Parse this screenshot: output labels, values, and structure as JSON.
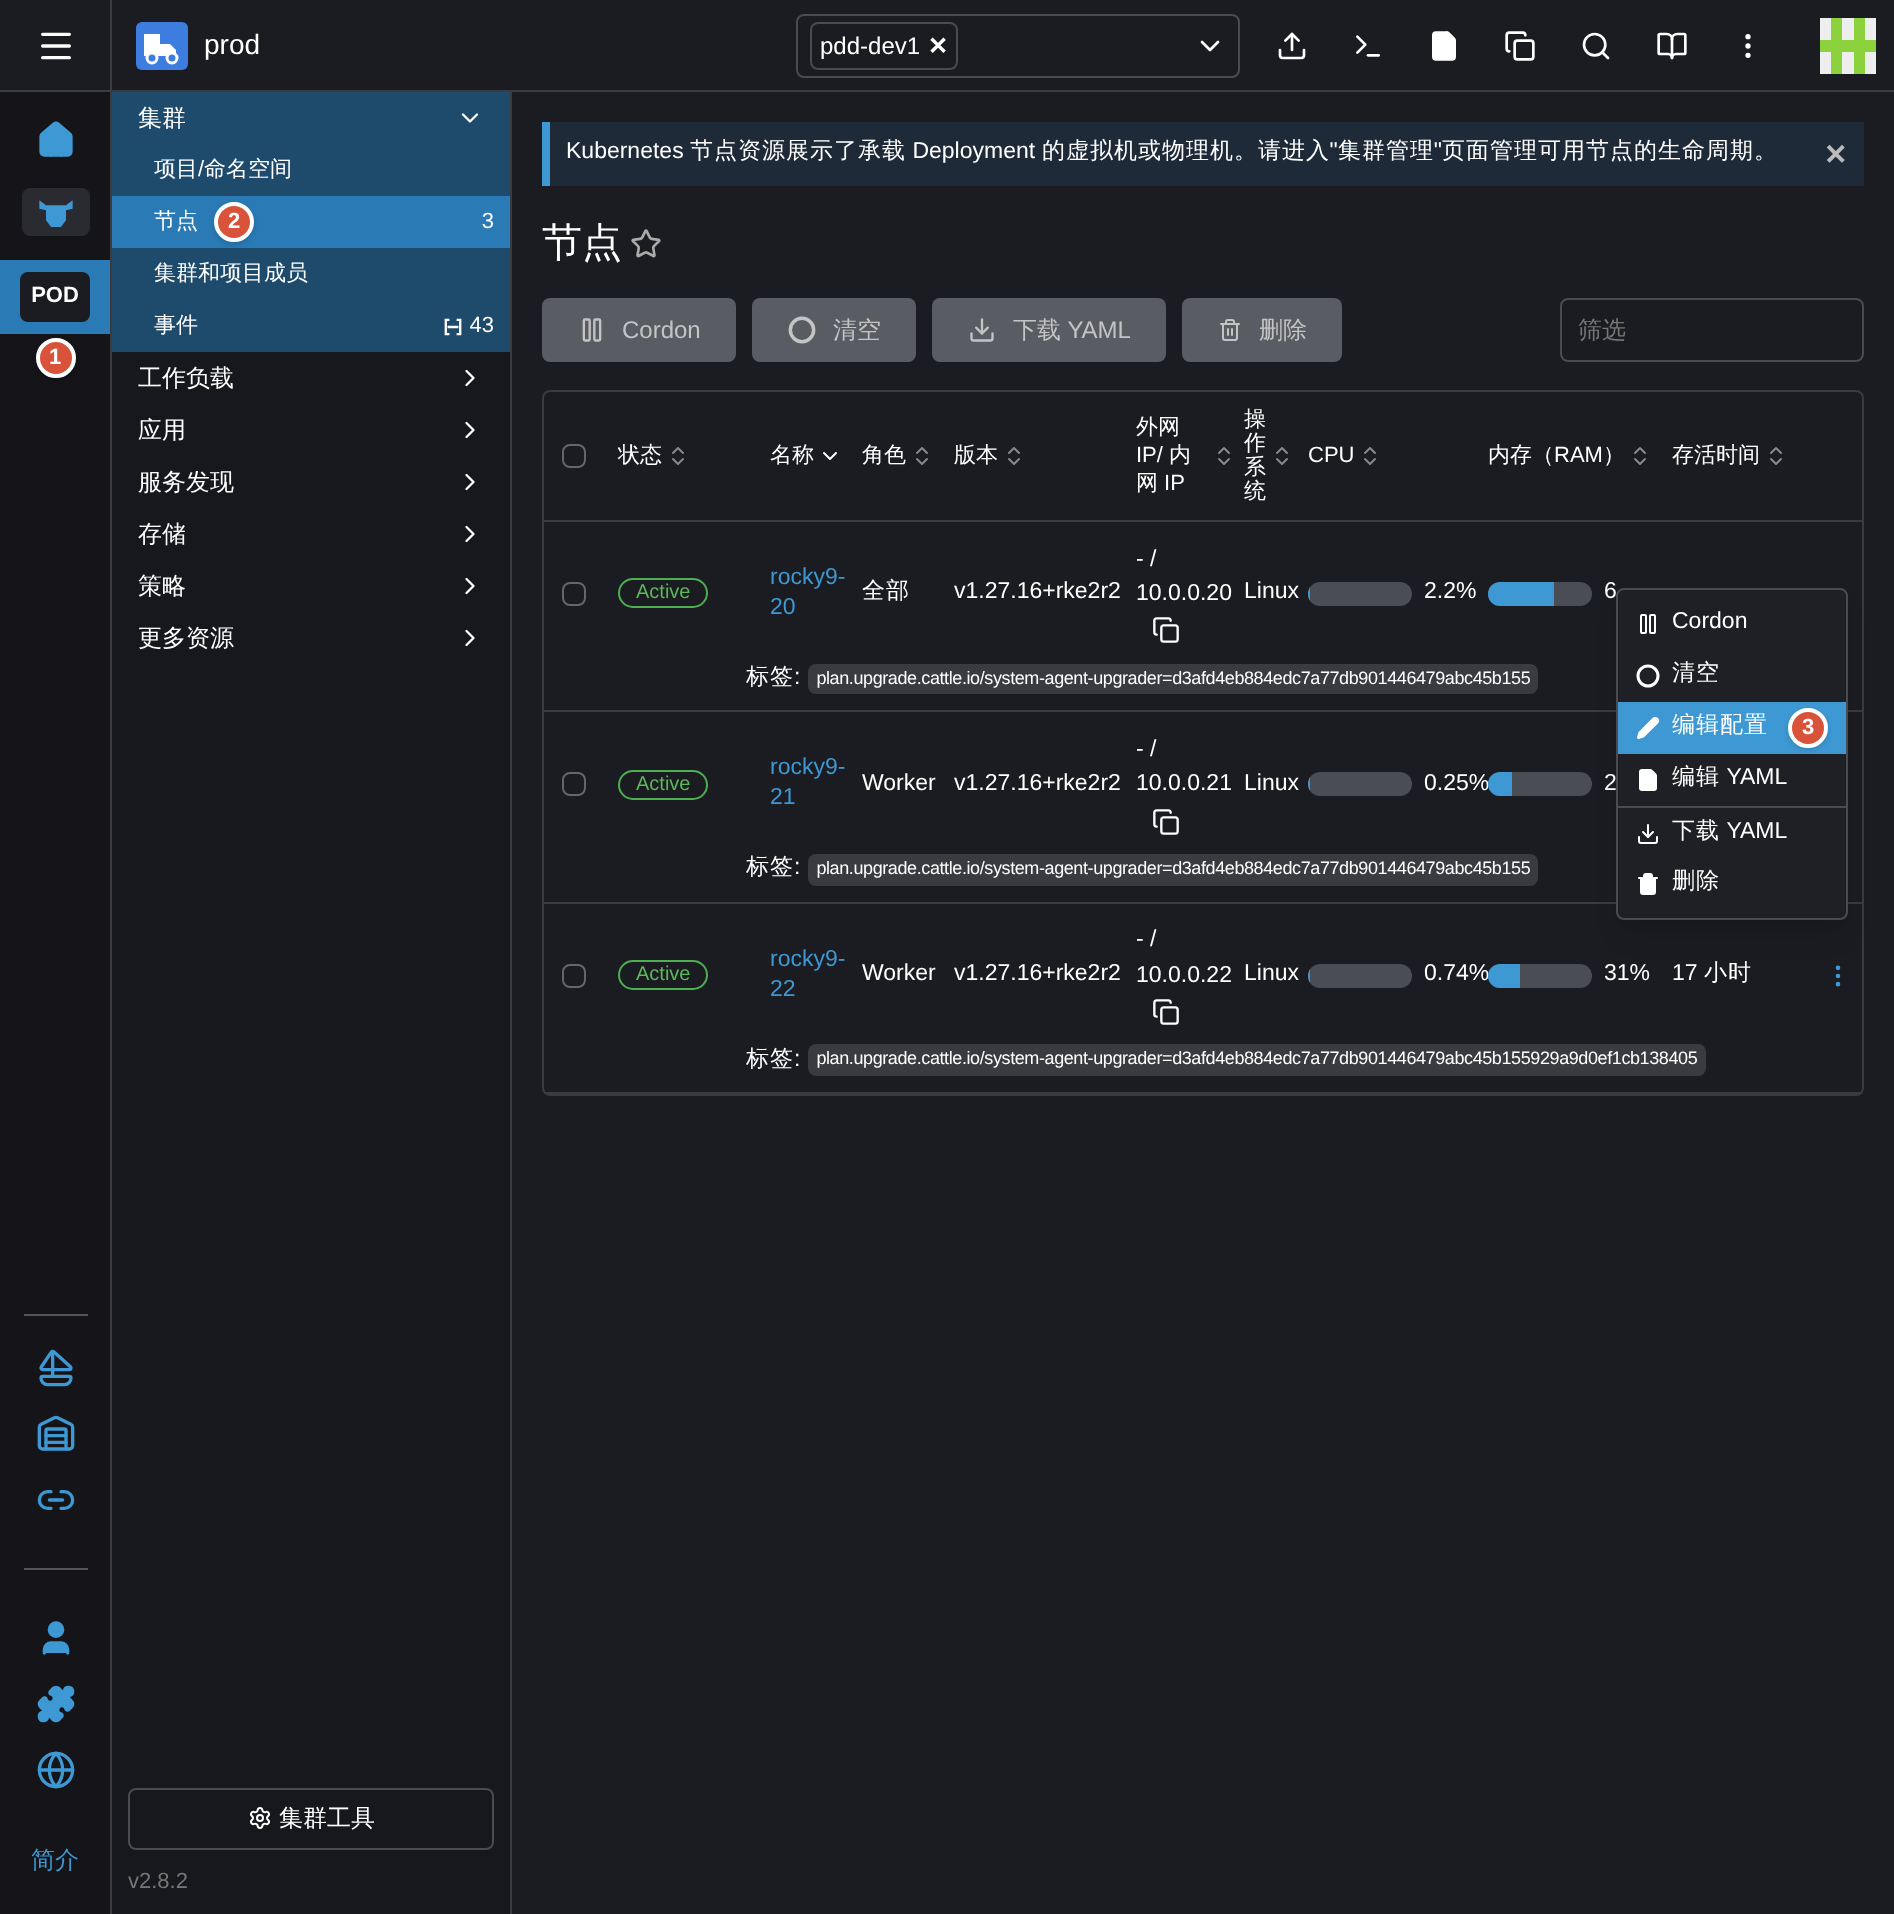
{
  "header": {
    "cluster": "prod",
    "namespace_chips": [
      {
        "label": "pdd-dev1",
        "remove": "✕"
      }
    ]
  },
  "rail": {
    "items": [
      {
        "kind": "home",
        "selected": false
      },
      {
        "kind": "cattle",
        "selected": false
      },
      {
        "kind": "label",
        "label": "POD",
        "selected": true,
        "marker": "1"
      }
    ],
    "apps": [
      {
        "kind": "sailboat"
      },
      {
        "kind": "fleet"
      },
      {
        "kind": "rings"
      }
    ],
    "tools": [
      {
        "kind": "user"
      },
      {
        "kind": "puzzle"
      },
      {
        "kind": "globe"
      }
    ],
    "about": "简介"
  },
  "nav": {
    "groups": [
      {
        "label": "集群",
        "expanded": true,
        "children": [
          {
            "label": "项目/命名空间",
            "selected": false
          },
          {
            "label": "节点",
            "selected": true,
            "count": "3",
            "count_icon": false,
            "marker": "2"
          },
          {
            "label": "集群和项目成员",
            "selected": false
          },
          {
            "label": "事件",
            "selected": false,
            "count": "43",
            "count_icon": true
          }
        ]
      },
      {
        "label": "工作负载",
        "expanded": false
      },
      {
        "label": "应用",
        "expanded": false
      },
      {
        "label": "服务发现",
        "expanded": false
      },
      {
        "label": "存储",
        "expanded": false
      },
      {
        "label": "策略",
        "expanded": false
      },
      {
        "label": "更多资源",
        "expanded": false
      }
    ],
    "cluster_tools": "集群工具",
    "version": "v2.8.2"
  },
  "banner": {
    "text": "Kubernetes 节点资源展示了承载 Deployment 的虚拟机或物理机。请进入\"集群管理\"页面管理可用节点的生命周期。",
    "close": "✕"
  },
  "page": {
    "title": "节点",
    "favorite": false
  },
  "actions": [
    {
      "label": "Cordon",
      "disabled": true
    },
    {
      "label": "清空",
      "disabled": true
    },
    {
      "label": "下载 YAML",
      "disabled": true
    },
    {
      "label": "删除",
      "disabled": true
    }
  ],
  "filter": {
    "placeholder": "筛选"
  },
  "table": {
    "select_all_checked": false,
    "columns": [
      {
        "kind": "text",
        "label": "状态",
        "sorted": false
      },
      {
        "kind": "text",
        "label": "名称",
        "sorted": true
      },
      {
        "kind": "text",
        "label": "角色",
        "sorted": false
      },
      {
        "kind": "text",
        "label": "版本",
        "sorted": false
      },
      {
        "kind": "text",
        "label": "外网 IP/ 内网 IP",
        "sorted": false
      },
      {
        "kind": "stacked",
        "label": "操作系统",
        "sorted": false
      },
      {
        "kind": "text",
        "label": "CPU",
        "sorted": false
      },
      {
        "kind": "text",
        "label": "内存（RAM）",
        "sorted": false
      },
      {
        "kind": "text",
        "label": "存活时间",
        "sorted": false
      }
    ],
    "rows": [
      {
        "checked": false,
        "state": "Active",
        "name": "rocky9-20",
        "role": "全部",
        "version": "v1.27.16+rke2r2",
        "ip": "- / 10.0.0.20",
        "os": "Linux",
        "cpu": {
          "level": 0.022,
          "reading": "2.2%"
        },
        "memory": {
          "level": 0.64,
          "reading": "6"
        },
        "label_key": "标签:",
        "label": "plan.upgrade.cattle.io/system-agent-upgrader=d3afd4eb884edc7a77db901446479abc45b155"
      },
      {
        "checked": false,
        "state": "Active",
        "name": "rocky9-21",
        "role": "Worker",
        "version": "v1.27.16+rke2r2",
        "ip": "- / 10.0.0.21",
        "os": "Linux",
        "cpu": {
          "level": 0.0025,
          "reading": "0.25%"
        },
        "memory": {
          "level": 0.23,
          "reading": "2"
        },
        "label_key": "标签:",
        "label": "plan.upgrade.cattle.io/system-agent-upgrader=d3afd4eb884edc7a77db901446479abc45b155"
      },
      {
        "checked": false,
        "state": "Active",
        "name": "rocky9-22",
        "role": "Worker",
        "version": "v1.27.16+rke2r2",
        "ip": "- / 10.0.0.22",
        "os": "Linux",
        "cpu": {
          "level": 0.0074,
          "reading": "0.74%"
        },
        "memory": {
          "level": 0.31,
          "reading": "31%"
        },
        "age": "17 小时",
        "label_key": "标签:",
        "label": "plan.upgrade.cattle.io/system-agent-upgrader=d3afd4eb884edc7a77db901446479abc45b155929a9d0ef1cb138405"
      }
    ]
  },
  "context_menu": {
    "items": [
      {
        "kind": "pause",
        "label": "Cordon",
        "selected": false
      },
      {
        "kind": "circle",
        "label": "清空",
        "selected": false
      },
      {
        "kind": "edit",
        "label": "编辑配置",
        "selected": true,
        "marker": "3"
      },
      {
        "kind": "file",
        "label": "编辑 YAML",
        "selected": false
      },
      {
        "kind": "download",
        "label": "下载 YAML",
        "selected": false,
        "divider_before": true
      },
      {
        "kind": "trash",
        "label": "删除",
        "selected": false
      }
    ]
  }
}
